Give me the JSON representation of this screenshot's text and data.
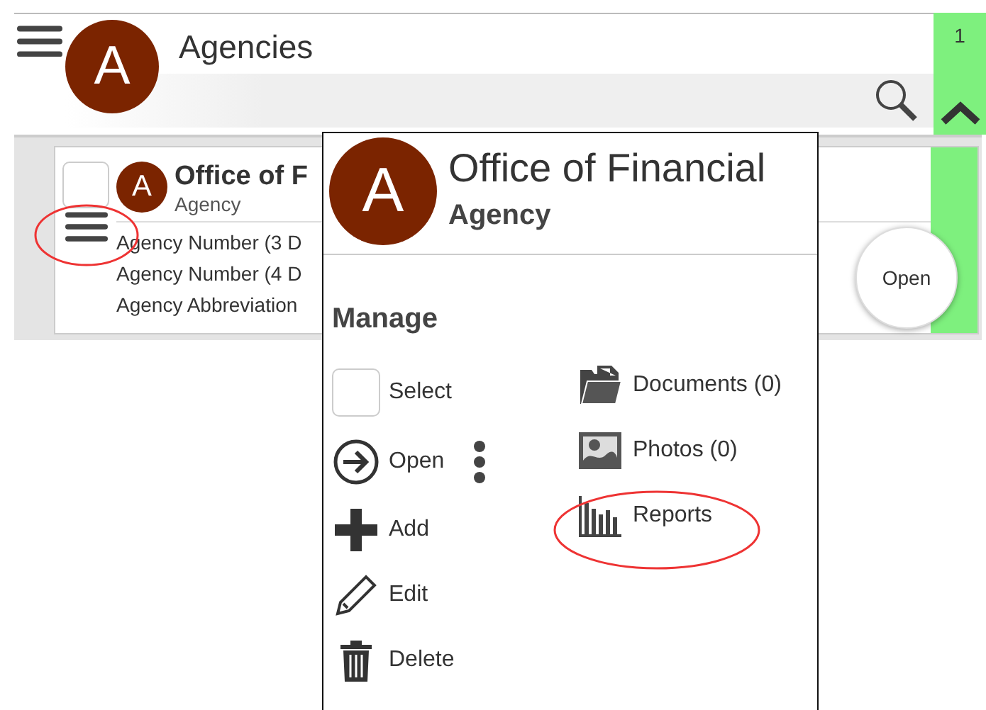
{
  "header": {
    "title": "Agencies",
    "avatar_letter": "A",
    "count": "1"
  },
  "list": {
    "items": [
      {
        "avatar_letter": "A",
        "title": "Office of F",
        "subtitle": "Agency",
        "checked": false,
        "fields": [
          "Agency Number (3 D",
          "Agency Number (4 D",
          "Agency Abbreviation"
        ],
        "action": "Open"
      }
    ]
  },
  "popup": {
    "avatar_letter": "A",
    "title": "Office of Financial",
    "subtitle": "Agency",
    "section": "Manage",
    "left_actions": [
      {
        "kind": "select",
        "label": "Select",
        "checked": false
      },
      {
        "kind": "open",
        "label": "Open"
      },
      {
        "kind": "add",
        "label": "Add"
      },
      {
        "kind": "edit",
        "label": "Edit"
      },
      {
        "kind": "delete",
        "label": "Delete"
      }
    ],
    "right_actions": [
      {
        "kind": "documents",
        "label": "Documents (0)"
      },
      {
        "kind": "photos",
        "label": "Photos (0)"
      },
      {
        "kind": "reports",
        "label": "Reports"
      }
    ]
  }
}
